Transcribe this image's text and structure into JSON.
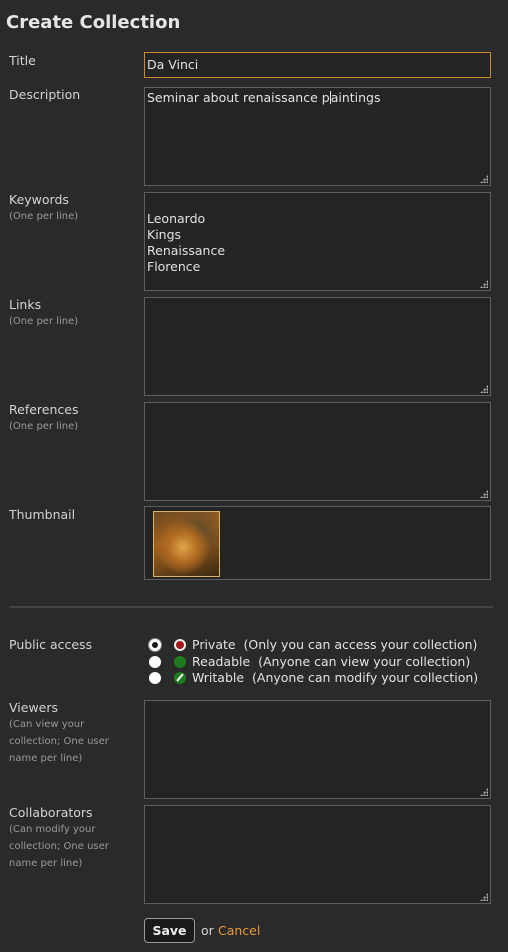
{
  "page_title": "Create Collection",
  "fields": {
    "title": {
      "label": "Title",
      "value": "Da Vinci"
    },
    "description": {
      "label": "Description",
      "value": "Seminar about renaissance paintings"
    },
    "keywords": {
      "label": "Keywords",
      "hint": "(One per line)",
      "value": "Leonardo\nKings\nRenaissance\nFlorence"
    },
    "links": {
      "label": "Links",
      "hint": "(One per line)",
      "value": ""
    },
    "references": {
      "label": "References",
      "hint": "(One per line)",
      "value": ""
    },
    "thumbnail": {
      "label": "Thumbnail"
    },
    "public_access": {
      "label": "Public access",
      "options": [
        {
          "name": "Private",
          "desc": "(Only you can access your collection)",
          "checked": true,
          "icon": "private-icon"
        },
        {
          "name": "Readable",
          "desc": "(Anyone can view your collection)",
          "checked": false,
          "icon": "readable-icon"
        },
        {
          "name": "Writable",
          "desc": "(Anyone can modify your collection)",
          "checked": false,
          "icon": "writable-icon"
        }
      ]
    },
    "viewers": {
      "label": "Viewers",
      "hint": "(Can view your collection; One user name per line)",
      "value": ""
    },
    "collaborators": {
      "label": "Collaborators",
      "hint": "(Can modify your collection; One user name per line)",
      "value": ""
    }
  },
  "actions": {
    "save_label": "Save",
    "or_text": "or",
    "cancel_label": "Cancel"
  },
  "colors": {
    "accent": "#e69a3c",
    "background": "#2a2a2a",
    "focus_border": "#c98a2c"
  }
}
